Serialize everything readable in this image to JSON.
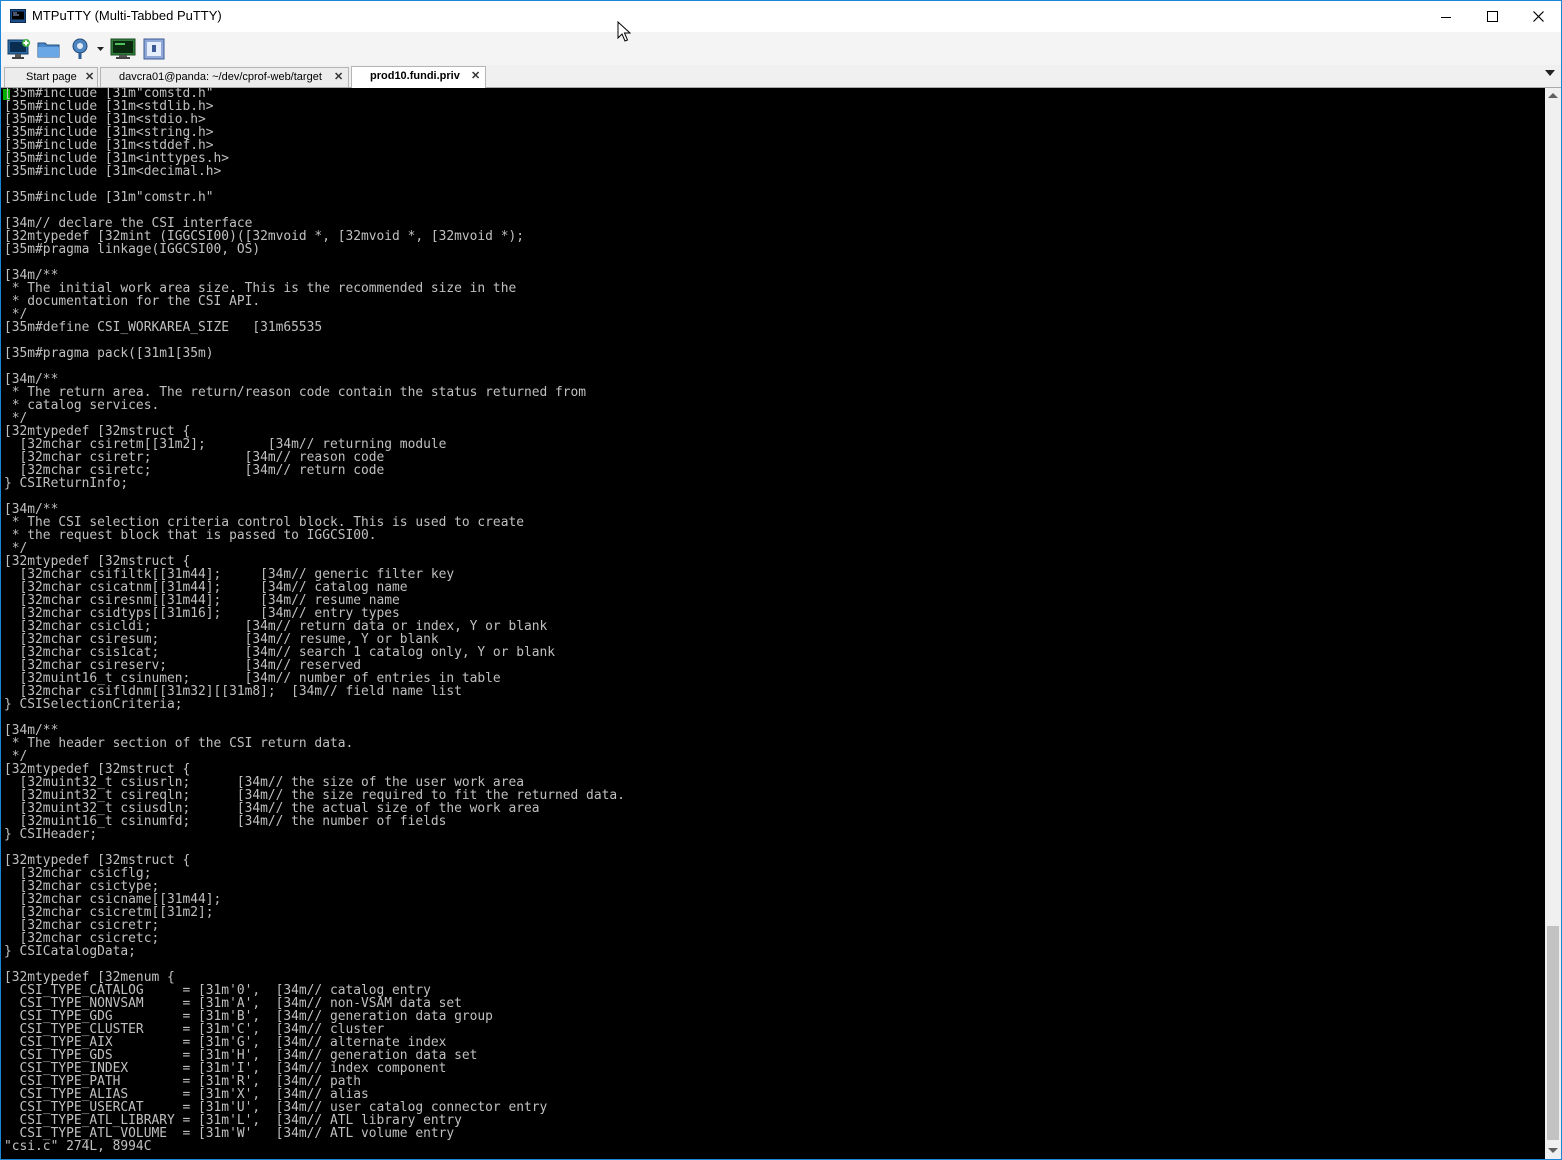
{
  "window": {
    "title": "MTPuTTY (Multi-Tabbed PuTTY)",
    "controls": {
      "minimize": "—",
      "maximize": "□",
      "close": "✕"
    }
  },
  "toolbar": {
    "icons": [
      "new-session-icon",
      "open-folder-icon",
      "settings-icon",
      "terminal-icon",
      "script-icon"
    ]
  },
  "tabs": [
    {
      "label": "Start page",
      "close": "✕",
      "active": false
    },
    {
      "label": "davcra01@panda: ~/dev/cprof-web/target",
      "close": "✕",
      "active": false
    },
    {
      "label": "prod10.fundi.priv",
      "close": "✕",
      "active": true
    }
  ],
  "terminal": {
    "lines": [
      "[35m#include [31m\"comstd.h\"",
      "[35m#include [31m<stdlib.h>",
      "[35m#include [31m<stdio.h>",
      "[35m#include [31m<string.h>",
      "[35m#include [31m<stddef.h>",
      "[35m#include [31m<inttypes.h>",
      "[35m#include [31m<decimal.h>",
      "",
      "[35m#include [31m\"comstr.h\"",
      "",
      "[34m// declare the CSI interface",
      "[32mtypedef [32mint (IGGCSI00)([32mvoid *, [32mvoid *, [32mvoid *);",
      "[35m#pragma linkage(IGGCSI00, OS)",
      "",
      "[34m/**",
      " * The initial work area size. This is the recommended size in the",
      " * documentation for the CSI API.",
      " */",
      "[35m#define CSI_WORKAREA_SIZE   [31m65535",
      "",
      "[35m#pragma pack([31m1[35m)",
      "",
      "[34m/**",
      " * The return area. The return/reason code contain the status returned from",
      " * catalog services.",
      " */",
      "[32mtypedef [32mstruct {",
      "  [32mchar csiretm[[31m2];        [34m// returning module",
      "  [32mchar csiretr;            [34m// reason code",
      "  [32mchar csiretc;            [34m// return code",
      "} CSIReturnInfo;",
      "",
      "[34m/**",
      " * The CSI selection criteria control block. This is used to create",
      " * the request block that is passed to IGGCSI00.",
      " */",
      "[32mtypedef [32mstruct {",
      "  [32mchar csifiltk[[31m44];     [34m// generic filter key",
      "  [32mchar csicatnm[[31m44];     [34m// catalog name",
      "  [32mchar csiresnm[[31m44];     [34m// resume name",
      "  [32mchar csidtyps[[31m16];     [34m// entry types",
      "  [32mchar csicldi;            [34m// return data or index, Y or blank",
      "  [32mchar csiresum;           [34m// resume, Y or blank",
      "  [32mchar csis1cat;           [34m// search 1 catalog only, Y or blank",
      "  [32mchar csireserv;          [34m// reserved",
      "  [32muint16_t csinumen;       [34m// number of entries in table",
      "  [32mchar csifldnm[[31m32][[31m8];  [34m// field name list",
      "} CSISelectionCriteria;",
      "",
      "[34m/**",
      " * The header section of the CSI return data.",
      " */",
      "[32mtypedef [32mstruct {",
      "  [32muint32_t csiusrln;      [34m// the size of the user work area",
      "  [32muint32_t csireqln;      [34m// the size required to fit the returned data.",
      "  [32muint32_t csiusdln;      [34m// the actual size of the work area",
      "  [32muint16_t csinumfd;      [34m// the number of fields",
      "} CSIHeader;",
      "",
      "[32mtypedef [32mstruct {",
      "  [32mchar csicflg;",
      "  [32mchar csictype;",
      "  [32mchar csicname[[31m44];",
      "  [32mchar csicretm[[31m2];",
      "  [32mchar csicretr;",
      "  [32mchar csicretc;",
      "} CSICatalogData;",
      "",
      "[32mtypedef [32menum {",
      "  CSI_TYPE_CATALOG     = [31m'0',  [34m// catalog entry",
      "  CSI_TYPE_NONVSAM     = [31m'A',  [34m// non-VSAM data set",
      "  CSI_TYPE_GDG         = [31m'B',  [34m// generation data group",
      "  CSI_TYPE_CLUSTER     = [31m'C',  [34m// cluster",
      "  CSI_TYPE_AIX         = [31m'G',  [34m// alternate index",
      "  CSI_TYPE_GDS         = [31m'H',  [34m// generation data set",
      "  CSI_TYPE_INDEX       = [31m'I',  [34m// index component",
      "  CSI_TYPE_PATH        = [31m'R',  [34m// path",
      "  CSI_TYPE_ALIAS       = [31m'X',  [34m// alias",
      "  CSI_TYPE_USERCAT     = [31m'U',  [34m// user catalog connector entry",
      "  CSI_TYPE_ATL_LIBRARY = [31m'L',  [34m// ATL library entry",
      "  CSI_TYPE_ATL_VOLUME  = [31m'W'   [34m// ATL volume entry",
      "\"csi.c\" 274L, 8994C"
    ]
  },
  "colors": {
    "terminal_bg": "#000000",
    "terminal_fg": "#c0c0c0",
    "cursor": "#00cd00",
    "title_border": "#1a86d9"
  }
}
